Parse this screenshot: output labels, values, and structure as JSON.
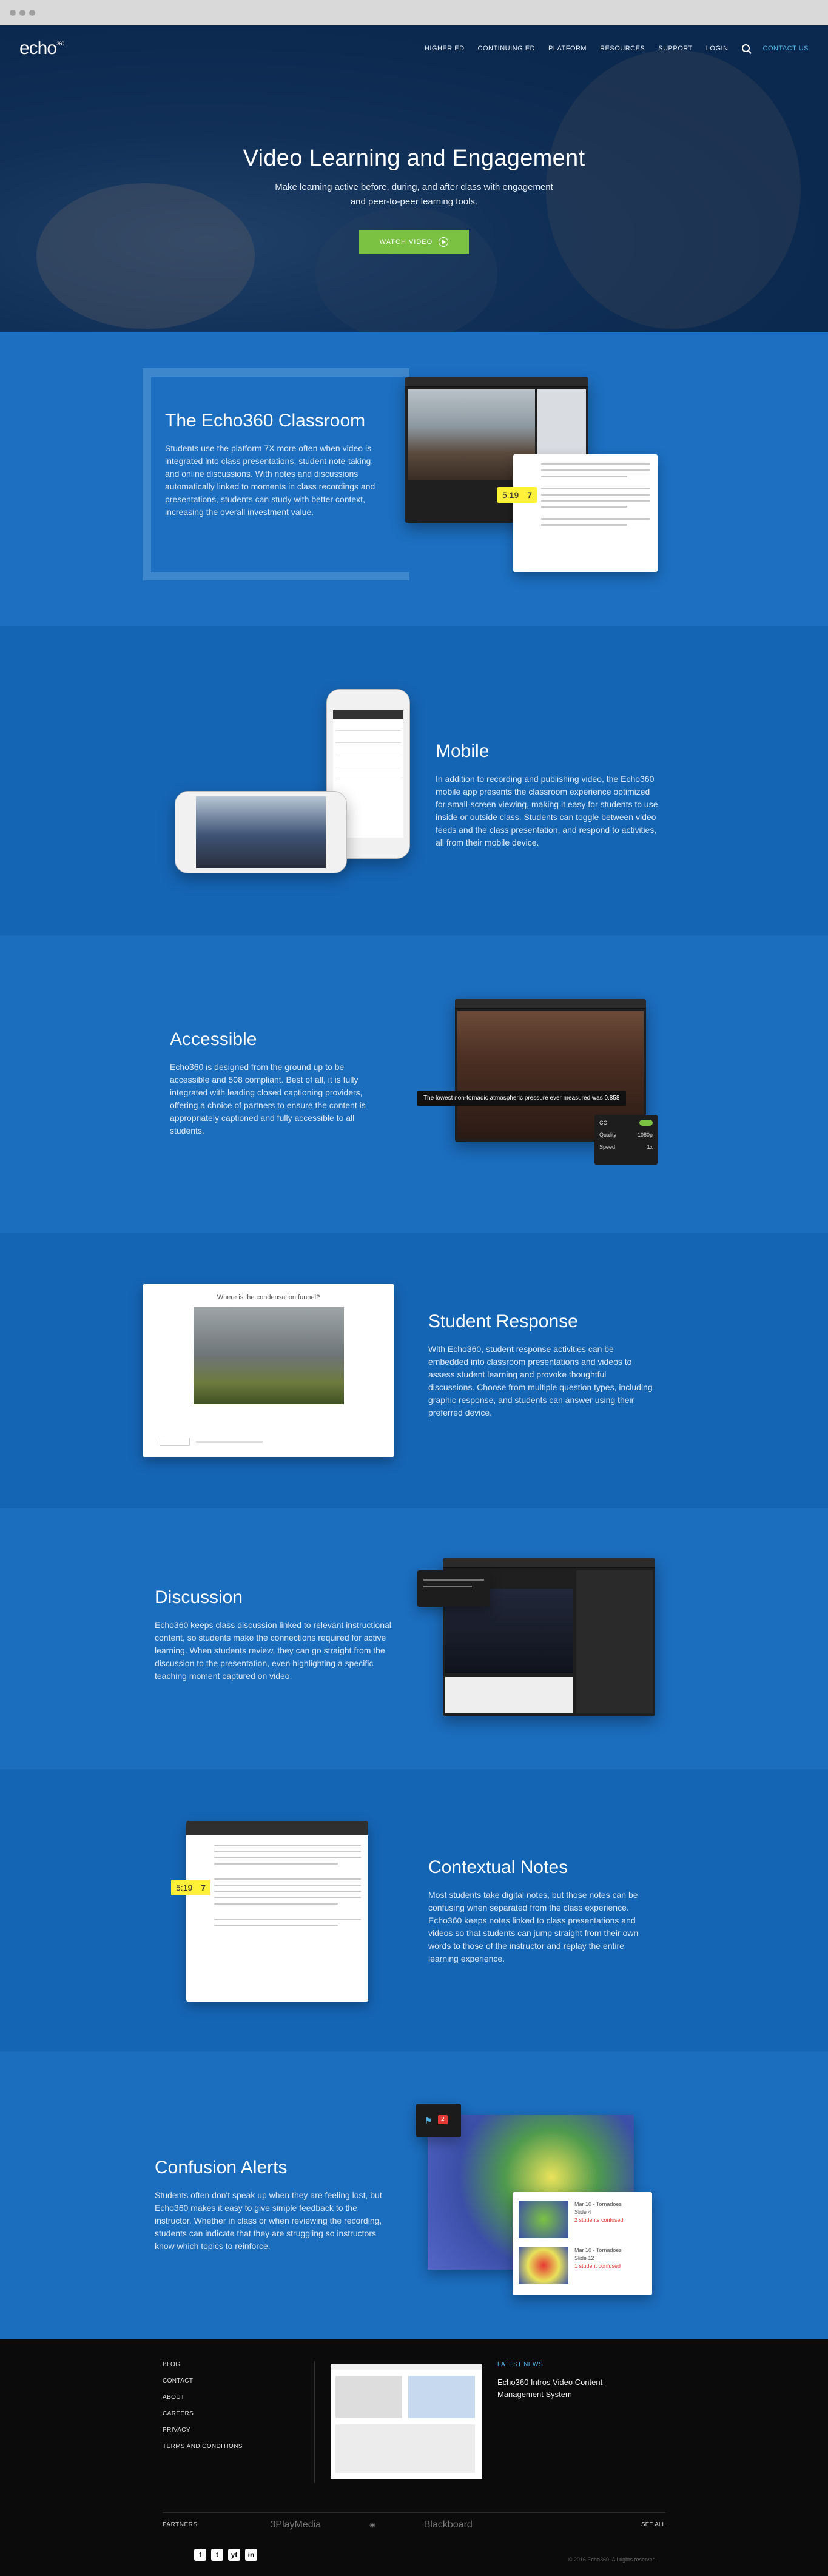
{
  "nav": {
    "logo": "echo",
    "logo_mark": "360",
    "links": [
      "HIGHER ED",
      "CONTINUING ED",
      "PLATFORM",
      "RESOURCES",
      "SUPPORT",
      "LOGIN"
    ],
    "search_icon": "search-icon",
    "contact": "CONTACT US"
  },
  "hero": {
    "title": "Video Learning and Engagement",
    "subtitle_1": "Make learning active before, during, and after class with engagement",
    "subtitle_2": "and peer-to-peer learning tools.",
    "cta": "WATCH VIDEO"
  },
  "sections": {
    "classroom": {
      "title": "The Echo360 Classroom",
      "body": "Students use the platform 7X more often when video is integrated into class presentations, student note-taking, and online discussions. With notes and discussions automatically linked to moments in class recordings and presentations, students can study with better context, increasing the overall investment value.",
      "stamp_time": "5:19",
      "stamp_num": "7"
    },
    "mobile": {
      "title": "Mobile",
      "body": "In addition to recording and publishing video, the Echo360 mobile app presents the classroom experience optimized for small-screen viewing, making it easy for students to use inside or outside class. Students can toggle between video feeds and the class presentation, and respond to activities, all from their mobile device."
    },
    "accessible": {
      "title": "Accessible",
      "body": "Echo360 is designed from the ground up to be accessible and 508 compliant. Best of all, it is fully integrated with leading closed captioning providers, offering a choice of partners to ensure the content is appropriately captioned and fully accessible to all students.",
      "caption": "The lowest non-tornadic atmospheric pressure ever measured was 0.858",
      "cc_label": "CC",
      "quality_label": "Quality",
      "quality_value": "1080p",
      "speed_label": "Speed",
      "speed_value": "1x"
    },
    "student_response": {
      "title": "Student Response",
      "body": "With Echo360, student response activities can be embedded into classroom presentations and videos to assess student learning and provoke thoughtful discussions. Choose from multiple question types, including graphic response, and students can answer using their preferred device.",
      "question": "Where is the condensation funnel?"
    },
    "discussion": {
      "title": "Discussion",
      "body": "Echo360 keeps class discussion linked to relevant instructional content, so students make the connections required for active learning. When students review, they can go straight from the discussion to the presentation, even highlighting a specific teaching moment captured on video."
    },
    "notes": {
      "title": "Contextual Notes",
      "body": "Most students take digital notes, but those notes can be confusing when separated from the class experience. Echo360 keeps notes linked to class presentations and videos so that students can jump straight from their own words to those of the instructor and replay the entire learning experience.",
      "stamp_time": "5:19",
      "stamp_num": "7"
    },
    "confusion": {
      "title": "Confusion Alerts",
      "body": "Students often don't speak up when they are feeling lost, but Echo360 makes it easy to give simple feedback to the instructor. Whether in class or when reviewing the recording, students can indicate that they are struggling so instructors know which topics to reinforce.",
      "flag_count": "2",
      "alert_1_title": "Mar 10 - Tornadoes",
      "alert_1_slide": "Slide 4",
      "alert_1_status": "2 students confused",
      "alert_2_title": "Mar 10 - Tornadoes",
      "alert_2_slide": "Slide 12",
      "alert_2_status": "1 student confused"
    }
  },
  "footer": {
    "links": [
      "BLOG",
      "CONTACT",
      "ABOUT",
      "CAREERS",
      "PRIVACY",
      "TERMS AND CONDITIONS"
    ],
    "latest_label": "LATEST NEWS",
    "latest_text": "Echo360 Intros Video Content Management System",
    "partners_label": "PARTNERS",
    "partners": [
      "3PlayMedia",
      "Blackboard"
    ],
    "see_all": "SEE ALL",
    "socials": [
      "f",
      "t",
      "yt",
      "in"
    ],
    "copyright": "© 2016 Echo360. All rights reserved."
  },
  "colors": {
    "accent_green": "#7cc242",
    "link_blue": "#4fb3e8",
    "section_blue": "#1b6dbe",
    "stamp_yellow": "#fff03a"
  }
}
